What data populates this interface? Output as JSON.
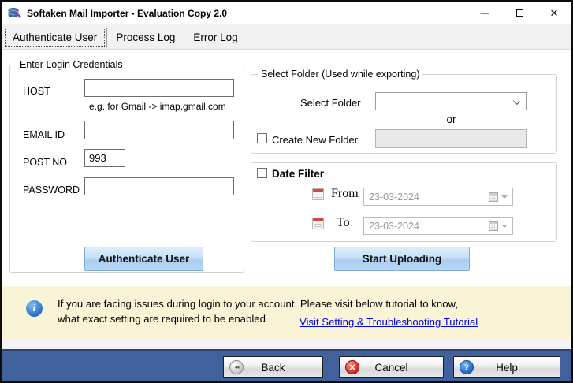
{
  "window": {
    "title": "Softaken Mail Importer - Evaluation Copy 2.0"
  },
  "icons": {
    "minimize_glyph": "—",
    "close_glyph": "✕",
    "back_glyph": "◂◂",
    "cancel_glyph": "✕",
    "help_glyph": "?",
    "info_glyph": "i"
  },
  "tabs": [
    {
      "label": "Authenticate User",
      "active": true
    },
    {
      "label": "Process Log",
      "active": false
    },
    {
      "label": "Error Log",
      "active": false
    }
  ],
  "credentials": {
    "group_title": "Enter Login Credentials",
    "host_label": "HOST",
    "host_value": "",
    "host_hint": "e.g. for Gmail -> imap.gmail.com",
    "email_label": "EMAIL ID",
    "email_value": "",
    "port_label": "POST NO",
    "port_value": "993",
    "password_label": "PASSWORD",
    "password_value": "",
    "authenticate_button": "Authenticate User"
  },
  "folder": {
    "group_title": "Select Folder (Used while exporting)",
    "select_label": "Select Folder",
    "select_value": "",
    "or_text": "or",
    "create_checkbox_label": "Create New Folder",
    "create_checkbox_checked": false,
    "create_value": ""
  },
  "date_filter": {
    "checkbox_label": "Date Filter",
    "checkbox_checked": false,
    "from_label": "From",
    "from_value": "23-03-2024",
    "to_label": "To",
    "to_value": "23-03-2024"
  },
  "upload": {
    "start_button": "Start Uploading"
  },
  "info_bar": {
    "line1": "If you are facing issues during login to your account. Please visit below tutorial to know,",
    "line2": "what exact setting are required to be enabled",
    "link": "Visit Setting & Troubleshooting Tutorial"
  },
  "footer": {
    "back": "Back",
    "cancel": "Cancel",
    "help": "Help"
  },
  "colors": {
    "action_button": "#b9d6f4",
    "footer_bg": "#40619c",
    "info_bg": "#f8f4d5",
    "link": "#0000e6"
  }
}
